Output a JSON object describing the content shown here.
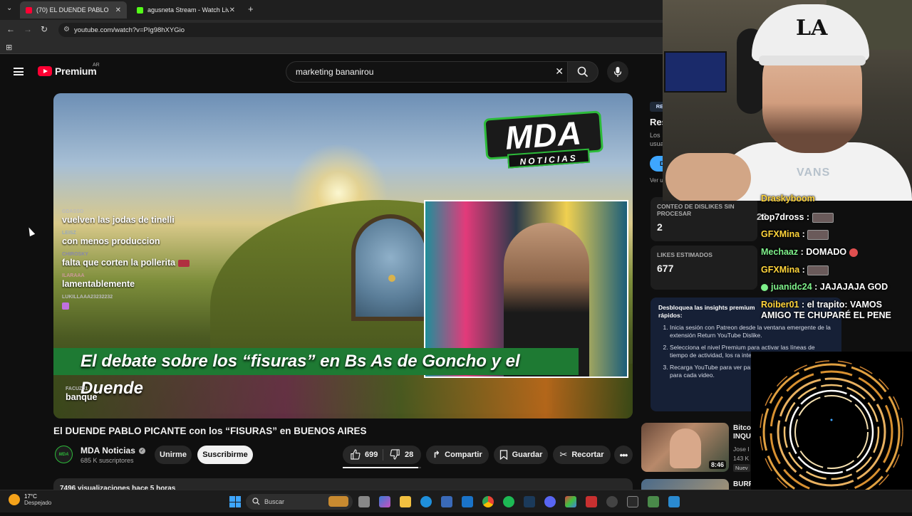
{
  "browser": {
    "tabs": [
      {
        "label": "(70) EL DUENDE PABLO PICANTE",
        "active": true,
        "favicon_color": "#ff0033"
      },
      {
        "label": "agusneta Stream - Watch Live o",
        "active": false,
        "favicon_color": "#53fc18"
      }
    ],
    "url": "youtube.com/watch?v=PIg98hXYGio"
  },
  "header": {
    "logo_text": "Premium",
    "region": "AR",
    "search_value": "marketing bananirou"
  },
  "video": {
    "overlay_logo_main": "MDA",
    "overlay_logo_sub": "NOTICIAS",
    "overlay_chat": [
      {
        "user": "GDASSO",
        "text": "vuelven las jodas de tinelli"
      },
      {
        "user": "LEISZ",
        "text": "con menos produccion"
      },
      {
        "user": "CHIROSKY",
        "text": "falta que corten la pollerita"
      },
      {
        "user": "ILARAAA",
        "text": "lamentablemente"
      },
      {
        "user": "LUKILLAAA23232232",
        "text": ""
      },
      {
        "user": "FACUZ01",
        "text": "banque"
      }
    ],
    "lower_third": "El debate sobre los “fisuras” en Bs As de Goncho y el Duende",
    "title": "El DUENDE PABLO PICANTE con los “FISURAS” en BUENOS AIRES"
  },
  "channel": {
    "avatar_text": "MDA",
    "name": "MDA Noticias",
    "subscribers": "685 K suscriptores",
    "join_label": "Unirme",
    "subscribe_label": "Suscribirme"
  },
  "actions": {
    "likes": "699",
    "dislikes": "28",
    "like_ratio": 0.96,
    "share_label": "Compartir",
    "save_label": "Guardar",
    "clip_label": "Recortar"
  },
  "description": {
    "views_line": "7496 visualizaciones hace 5 horas"
  },
  "side_panel": {
    "badge": "RE",
    "title": "Res",
    "desc_lines": [
      "Los",
      "usua"
    ],
    "button_label": "D",
    "ver_label": "Ver u",
    "raw_dislikes_label": "CONTEO DE DISLIKES SIN PROCESAR",
    "raw_dislikes_value": "2",
    "estimated_likes_label": "LIKES ESTIMADOS",
    "estimated_likes_value": "677",
    "hidden_value": "26",
    "insights_title": "Desbloquea las insights premium",
    "insights_title_2": "rápidos:",
    "insights_steps": [
      "Inicia sesión con Patreon desde la ventana emergente de la extensión Return YouTube Dislike.",
      "Selecciona el nivel Premium para activar las líneas de tiempo de actividad, los ra interactivo.",
      "Recarga YouTube para ver países principales y el desg UU. para cada video."
    ]
  },
  "recommendations": [
    {
      "title_line1": "Bitco",
      "title_line2": "INQU",
      "meta1": "Jose I",
      "meta2": "143 K",
      "duration": "8:46",
      "badge": "Nuev"
    },
    {
      "title_line1": "BURR",
      "title_line2": "",
      "meta1": "",
      "meta2": "",
      "duration": "",
      "badge": ""
    }
  ],
  "stream_overlay": {
    "cap_text": "LA",
    "shirt_text": "VANS",
    "chat": [
      {
        "user": "Draskyboom",
        "text": "",
        "color": "#ffd43b"
      },
      {
        "user": "top7dross",
        "text": "",
        "color": "#ffffff"
      },
      {
        "user": "GFXMina",
        "text": "",
        "color": "#ffd43b"
      },
      {
        "user": "Mechaaz",
        "text": "DOMADO",
        "color": "#7ef08a"
      },
      {
        "user": "GFXMina",
        "text": "",
        "color": "#ffd43b"
      },
      {
        "user": "juanidc24",
        "text": "JAJAJAJA GOD",
        "color": "#7ef08a"
      },
      {
        "user": "Roiber01",
        "text": "el trapito: VAMOS AMIGO TE CHUPARÉ EL PENE",
        "color": "#ffd43b"
      }
    ]
  },
  "taskbar": {
    "temperature": "17°C",
    "condition": "Despejado",
    "search_placeholder": "Buscar"
  }
}
